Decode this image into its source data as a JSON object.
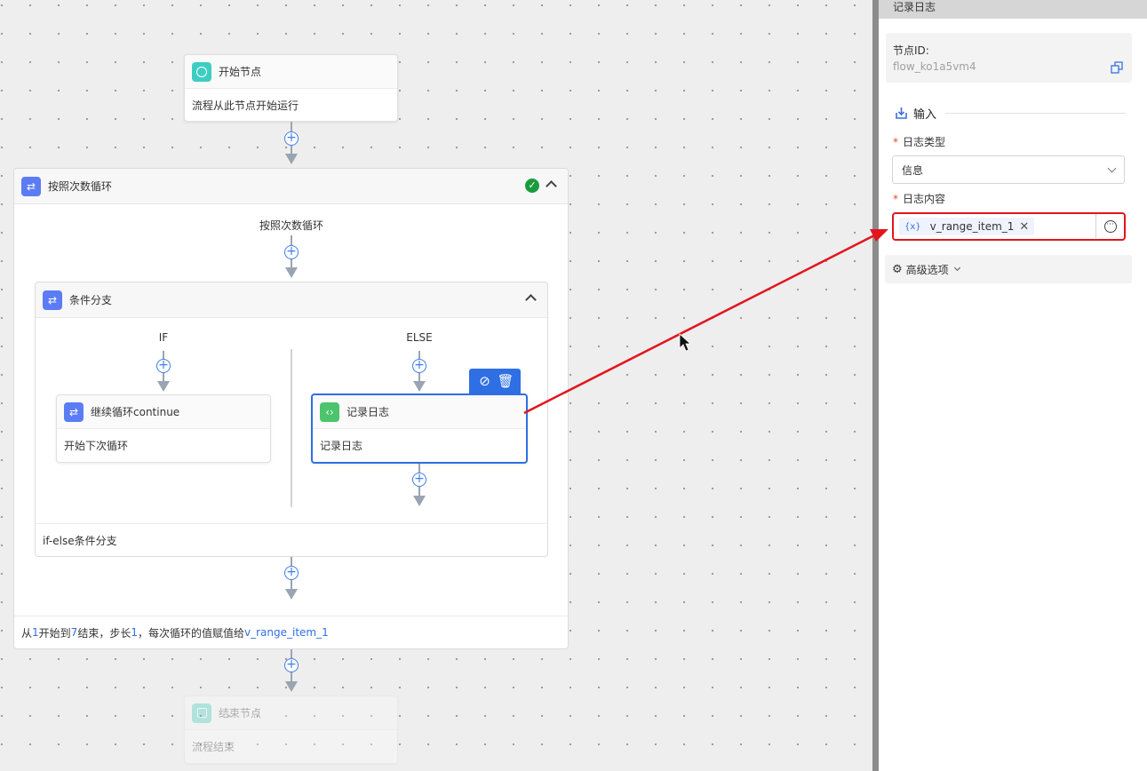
{
  "flow": {
    "start_node": {
      "title": "开始节点",
      "desc": "流程从此节点开始运行"
    },
    "loop": {
      "title": "按照次数循环",
      "inner_label": "按照次数循环",
      "footer": {
        "p1": "从 ",
        "start": "1",
        "p2": " 开始到 ",
        "end": "7",
        "p3": " 结束，步长 ",
        "step": "1",
        "p4": " ，每次循环的值赋值给 ",
        "var": "v_range_item_1"
      }
    },
    "branch": {
      "title": "条件分支",
      "if_label": "IF",
      "else_label": "ELSE",
      "footer": "if-else条件分支"
    },
    "continue_node": {
      "title": "继续循环continue",
      "desc": "开始下次循环"
    },
    "log_node": {
      "title": "记录日志",
      "desc": "记录日志"
    },
    "end_node": {
      "title": "结束节点",
      "desc": "流程结束"
    }
  },
  "panel": {
    "title": "记录日志",
    "node_id_label": "节点ID:",
    "node_id_value": "flow_ko1a5vm4",
    "input_section": "输入",
    "log_type_label": "日志类型",
    "log_type_value": "信息",
    "log_content_label": "日志内容",
    "variable_tag": "v_range_item_1",
    "variable_prefix": "{x}",
    "advanced_label": "高级选项"
  },
  "colors": {
    "accent_blue": "#2f6fe4",
    "annotation_red": "#e3141d",
    "success_green": "#1a9c3e"
  }
}
